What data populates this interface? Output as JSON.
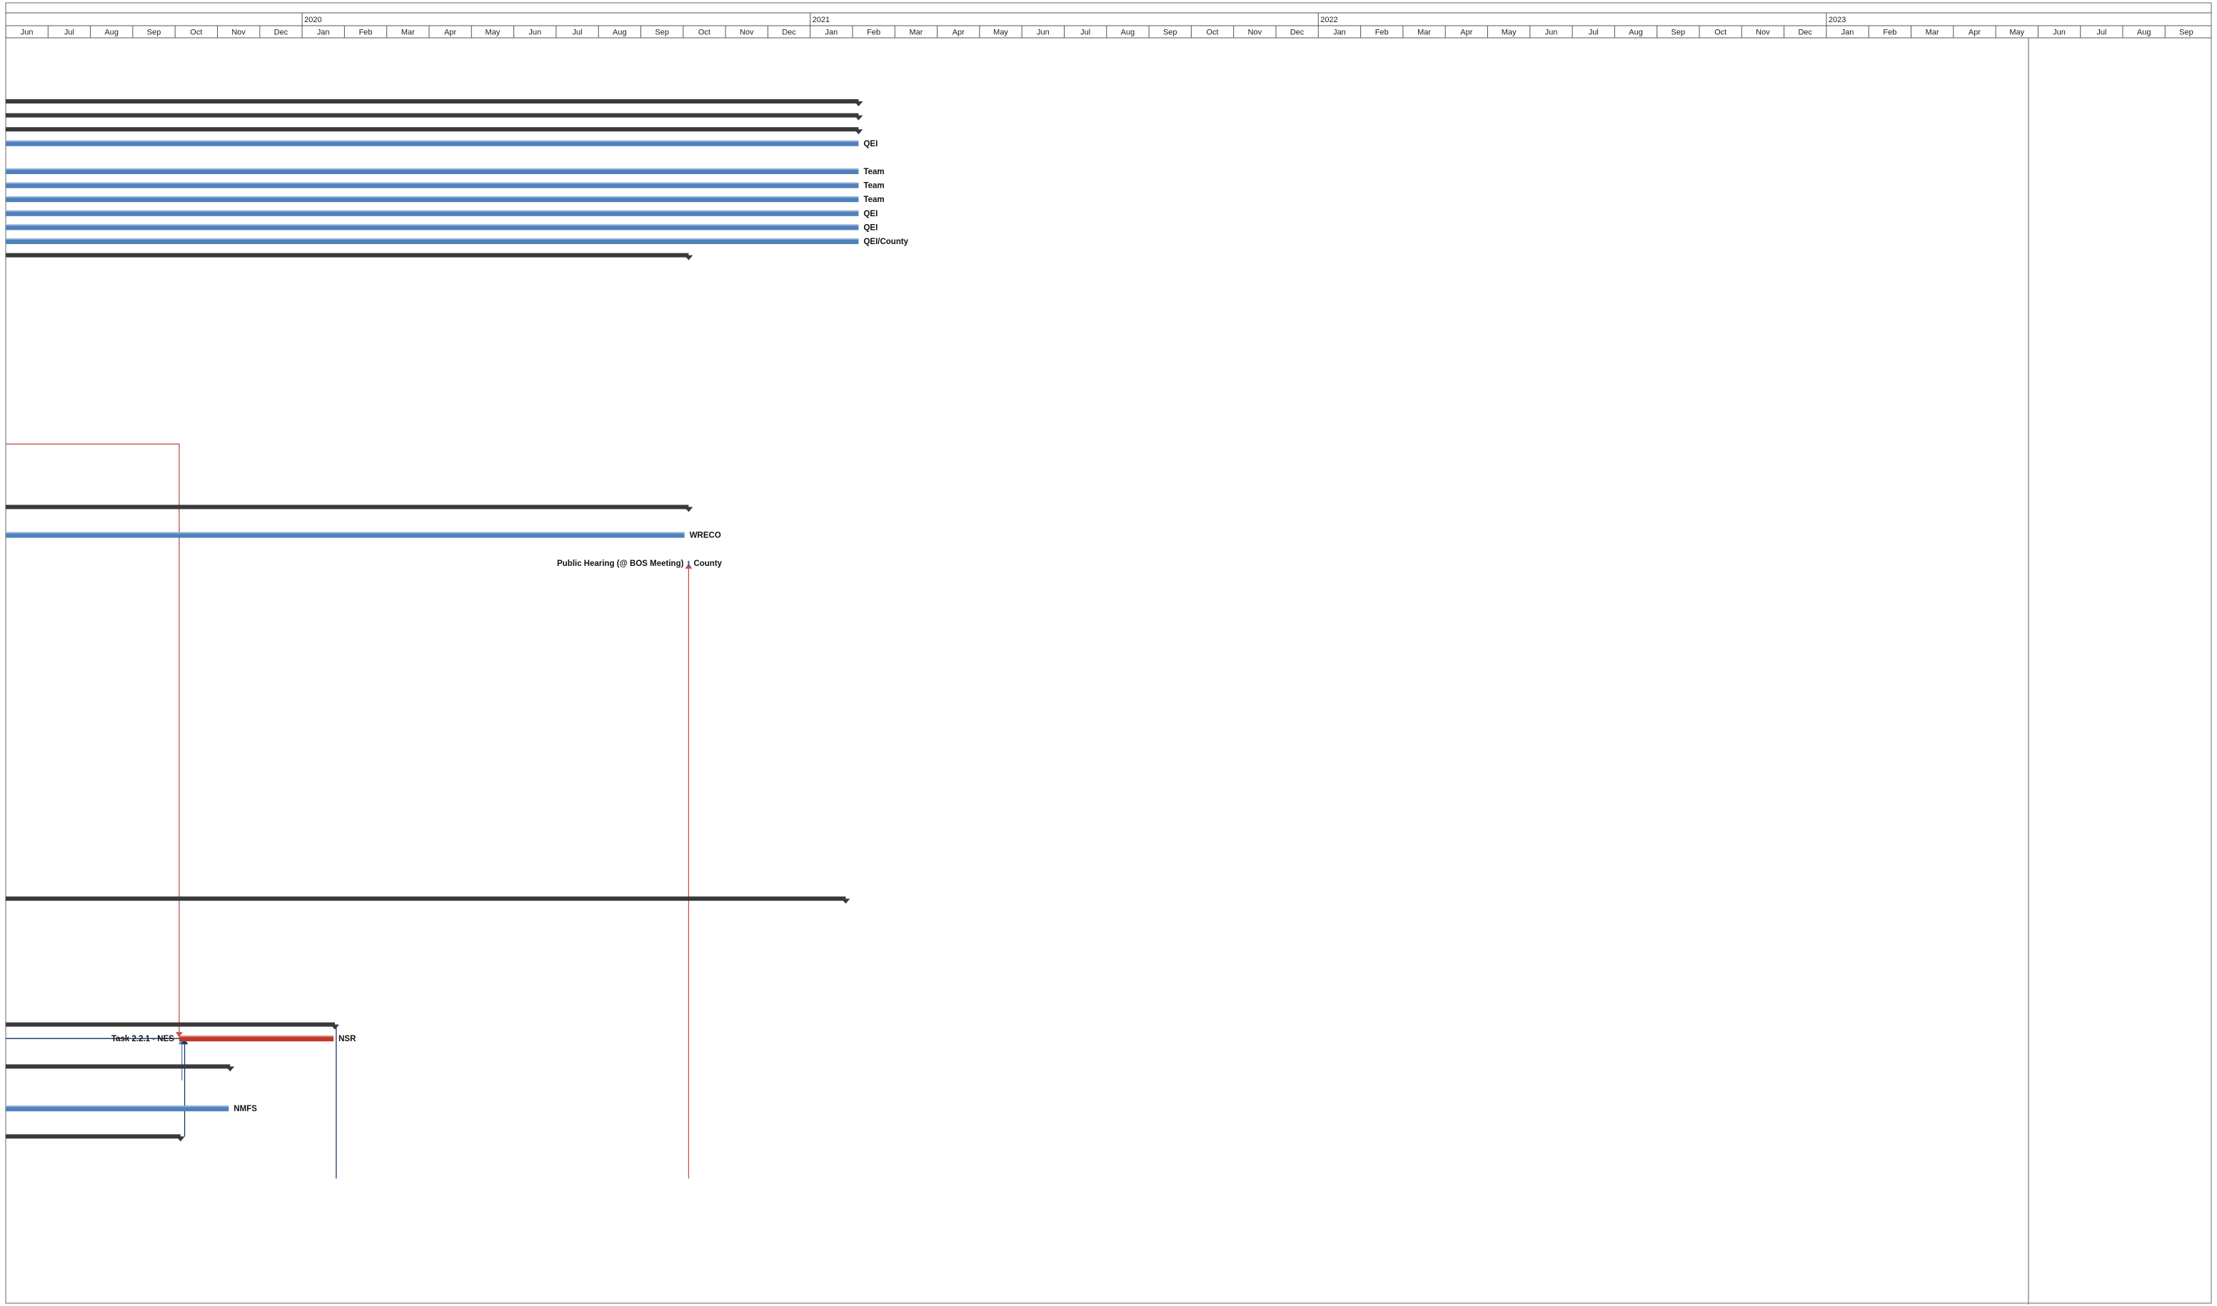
{
  "timeline": {
    "years": [
      {
        "label": "2020",
        "start": "2020-01"
      },
      {
        "label": "2021",
        "start": "2021-01"
      },
      {
        "label": "2022",
        "start": "2022-01"
      },
      {
        "label": "2023",
        "start": "2023-01"
      }
    ],
    "months": [
      "Jun",
      "Jul",
      "Aug",
      "Sep",
      "Oct",
      "Nov",
      "Dec",
      "Jan",
      "Feb",
      "Mar",
      "Apr",
      "May",
      "Jun",
      "Jul",
      "Aug",
      "Sep",
      "Oct",
      "Nov",
      "Dec",
      "Jan",
      "Feb",
      "Mar",
      "Apr",
      "May",
      "Jun",
      "Jul",
      "Aug",
      "Sep",
      "Oct",
      "Nov",
      "Dec",
      "Jan",
      "Feb",
      "Mar",
      "Apr",
      "May",
      "Jun",
      "Jul",
      "Aug",
      "Sep",
      "Oct",
      "Nov",
      "Dec",
      "Jan",
      "Feb",
      "Mar",
      "Apr",
      "May",
      "Jun",
      "Jul",
      "Aug",
      "Sep"
    ],
    "first_month": "2019-06",
    "status_date": "2023-05-25"
  },
  "rows": [
    {
      "row": 0,
      "type": "summary",
      "start": "2019-06-01",
      "end": "2021-02-05",
      "label": ""
    },
    {
      "row": 1,
      "type": "summary",
      "start": "2019-06-01",
      "end": "2021-02-05",
      "label": ""
    },
    {
      "row": 2,
      "type": "summary",
      "start": "2019-06-01",
      "end": "2021-02-05",
      "label": ""
    },
    {
      "row": 3,
      "type": "task",
      "start": "2019-06-01",
      "end": "2021-02-05",
      "label": "QEI"
    },
    {
      "row": 5,
      "type": "task",
      "start": "2019-06-01",
      "end": "2021-02-05",
      "label": "Team"
    },
    {
      "row": 6,
      "type": "task",
      "start": "2019-06-01",
      "end": "2021-02-05",
      "label": "Team"
    },
    {
      "row": 7,
      "type": "task",
      "start": "2019-06-01",
      "end": "2021-02-05",
      "label": "Team"
    },
    {
      "row": 8,
      "type": "task",
      "start": "2019-06-01",
      "end": "2021-02-05",
      "label": "QEI"
    },
    {
      "row": 9,
      "type": "task",
      "start": "2019-06-01",
      "end": "2021-02-05",
      "label": "QEI"
    },
    {
      "row": 10,
      "type": "task",
      "start": "2019-06-01",
      "end": "2021-02-05",
      "label": "QEI/County"
    },
    {
      "row": 11,
      "type": "summary",
      "start": "2019-06-01",
      "end": "2020-10-05",
      "label": ""
    },
    {
      "row": 29,
      "type": "summary",
      "start": "2019-06-01",
      "end": "2020-10-05",
      "label": ""
    },
    {
      "row": 31,
      "type": "task",
      "start": "2019-06-01",
      "end": "2020-10-02",
      "label": "WRECO"
    },
    {
      "row": 33,
      "type": "milestone",
      "start": "2020-10-05",
      "end": "2020-10-05",
      "label": "County",
      "left_label": "Public Hearing (@ BOS Meeting)"
    },
    {
      "row": 57,
      "type": "summary",
      "start": "2019-06-01",
      "end": "2021-01-27",
      "label": ""
    },
    {
      "row": 66,
      "type": "summary",
      "start": "2019-06-01",
      "end": "2020-01-25",
      "label": ""
    },
    {
      "row": 67,
      "type": "critical",
      "start": "2019-10-04",
      "end": "2020-01-24",
      "label": "NSR",
      "left_label": "Task 2.2.1 - NES"
    },
    {
      "row": 69,
      "type": "summary",
      "start": "2019-06-01",
      "end": "2019-11-10",
      "label": ""
    },
    {
      "row": 72,
      "type": "task",
      "start": "2019-06-01",
      "end": "2019-11-09",
      "label": "NMFS"
    },
    {
      "row": 74,
      "type": "summary",
      "start": "2019-06-01",
      "end": "2019-10-05",
      "label": ""
    }
  ],
  "links": [
    {
      "color": "#c0504d",
      "top_row": 24.5,
      "bottom_row": 67,
      "date": "2019-10-04",
      "from_left": true
    },
    {
      "color": "#4f81bd",
      "top_row": 67,
      "bottom_row": 70,
      "date": "2019-10-06",
      "from_left": true,
      "up": true
    },
    {
      "color": "#1f3864",
      "top_row": 67,
      "bottom_row": 74,
      "date": "2019-10-08",
      "from_left": true,
      "up": true
    },
    {
      "color": "#c0504d",
      "top_row": 33,
      "bottom_row": 77,
      "date": "2020-10-05",
      "from_left": false,
      "up": true
    },
    {
      "color": "#1f3864",
      "top_row": 66,
      "bottom_row": 77,
      "date": "2020-01-26",
      "from_left": false
    }
  ],
  "colors": {
    "summary": "#3a3a3a",
    "task": "#4f81bd",
    "task_dark": "#2e5c8a",
    "critical": "#c0392b",
    "status_line": "#7f7f7f",
    "grid": "#9a9a9a"
  }
}
